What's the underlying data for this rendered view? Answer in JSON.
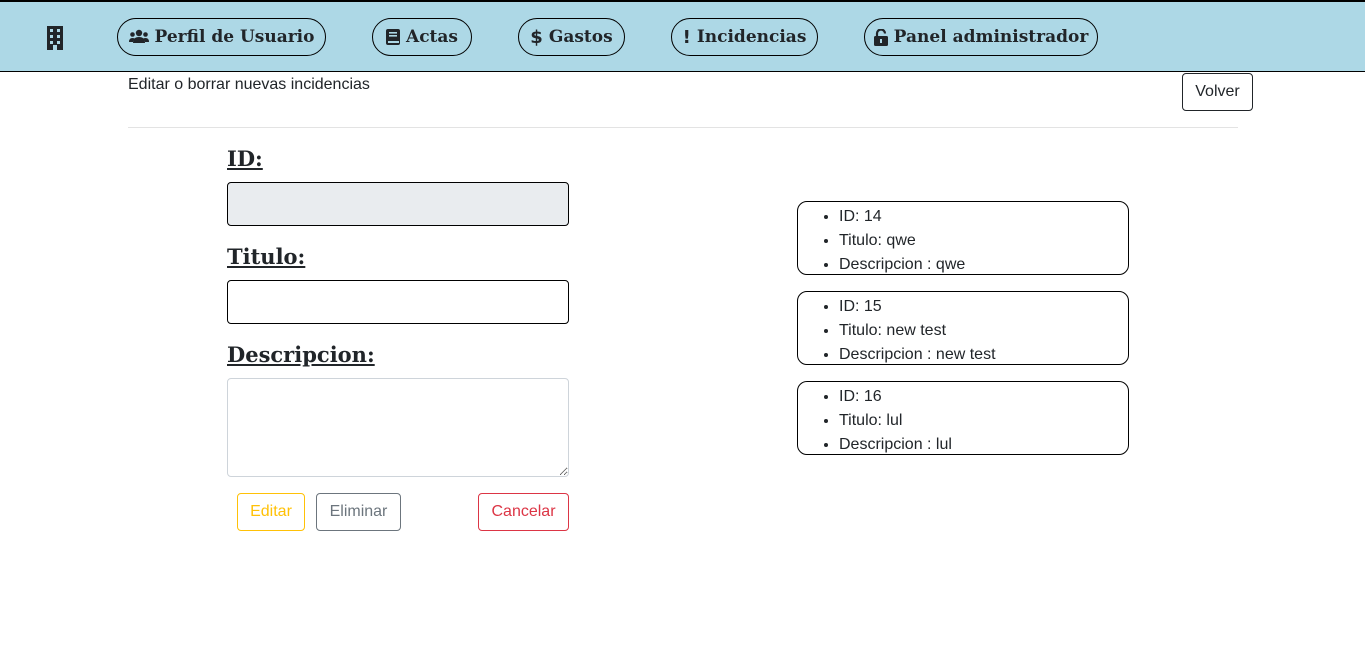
{
  "nav": {
    "brand_icon": "building-icon",
    "items": [
      {
        "label": "Perfil de Usuario",
        "icon": "users-icon"
      },
      {
        "label": "Actas",
        "icon": "book-icon"
      },
      {
        "label": "Gastos",
        "icon": "dollar-icon"
      },
      {
        "label": "Incidencias",
        "icon": "exclamation-icon"
      },
      {
        "label": "Panel administrador",
        "icon": "unlock-icon"
      }
    ]
  },
  "header": {
    "subtitle": "Editar o borrar nuevas incidencias",
    "back_label": "Volver"
  },
  "form": {
    "id_label": "ID:",
    "id_value": "",
    "title_label": "Titulo:",
    "title_value": "",
    "description_label": "Descripcion:",
    "description_value": "",
    "edit_label": "Editar",
    "delete_label": "Eliminar",
    "cancel_label": "Cancelar"
  },
  "incidencias": [
    {
      "id": "ID: 14",
      "titulo": "Titulo: qwe",
      "descripcion": "Descripcion : qwe"
    },
    {
      "id": "ID: 15",
      "titulo": "Titulo: new test",
      "descripcion": "Descripcion : new test"
    },
    {
      "id": "ID: 16",
      "titulo": "Titulo: lul",
      "descripcion": "Descripcion : lul"
    }
  ],
  "colors": {
    "navbar_bg": "#add8e6",
    "edit": "#ffc107",
    "delete": "#6c757d",
    "cancel": "#dc3545"
  }
}
